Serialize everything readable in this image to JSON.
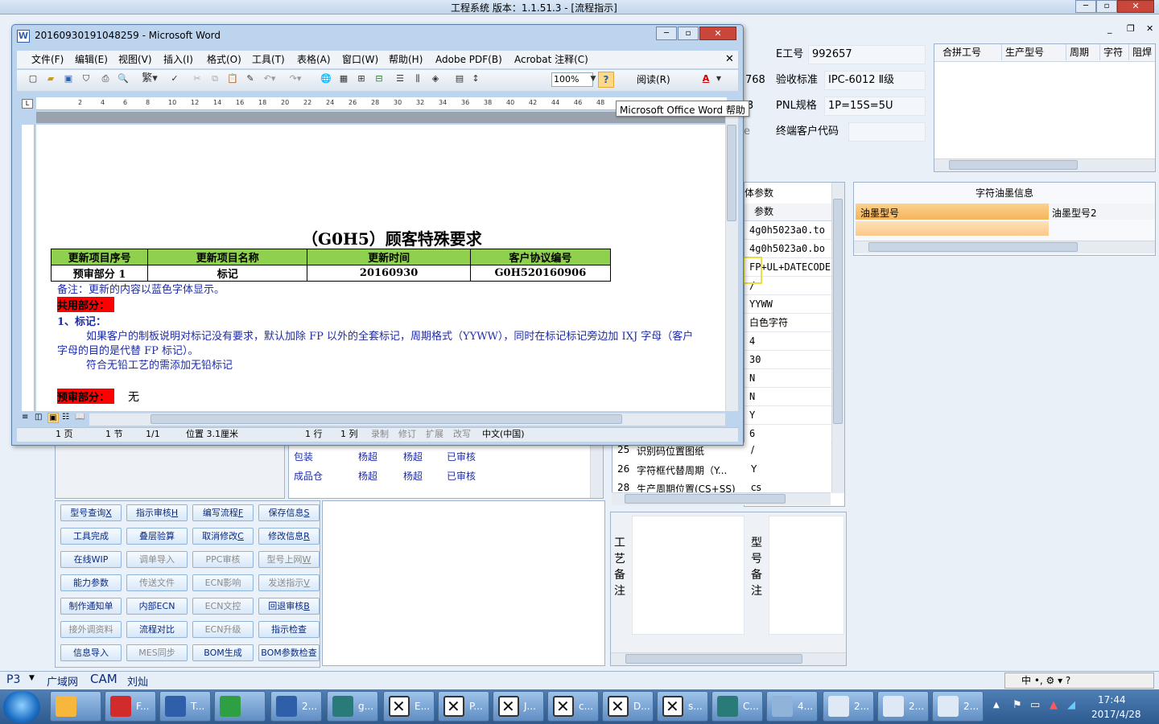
{
  "app": {
    "title": "工程系统   版本：1.1.51.3 - [流程指示]"
  },
  "top_fields": {
    "e_label": "E工号",
    "e_value": "992657",
    "acc_label": "验收标准",
    "acc_value": "IPC-6012 Ⅱ级",
    "acc_prefix": "768",
    "pnl_label": "PNL规格",
    "pnl_value": "1P=15S=5U",
    "pnl_prefix": "3",
    "client_label": "终端客户代码",
    "client_value": "",
    "client_prefix": "e"
  },
  "merge_grid": {
    "columns": [
      "合拼工号",
      "生产型号",
      "周期",
      "字符",
      "阻焊"
    ]
  },
  "params_panel": {
    "title_partial": "体参数",
    "col": "参数",
    "rows": [
      "4g0h5023a0.to",
      "4g0h5023a0.bo",
      "FP+UL+DATECODE",
      "/",
      "YYWW",
      "白色字符",
      "4",
      "30",
      "N",
      "N",
      "Y",
      "6"
    ]
  },
  "ink_panel": {
    "title": "字符油墨信息",
    "col1": "油墨型号",
    "col2": "油墨型号2"
  },
  "bottom_params": [
    {
      "no": "25",
      "name": "识别码位置图纸",
      "val": "/"
    },
    {
      "no": "26",
      "name": "字符框代替周期（Y...",
      "val": "Y"
    },
    {
      "no": "28",
      "name": "生产周期位置(CS+SS)",
      "val": "cs"
    }
  ],
  "approval_rows": [
    {
      "dept": "包装",
      "p1": "杨超",
      "p2": "杨超",
      "status": "已审核"
    },
    {
      "dept": "成品仓",
      "p1": "杨超",
      "p2": "杨超",
      "status": "已审核"
    }
  ],
  "buttons": [
    {
      "label": "型号查询",
      "key": "X",
      "dis": false
    },
    {
      "label": "指示审核",
      "key": "H",
      "dis": false
    },
    {
      "label": "编写流程",
      "key": "F",
      "dis": false
    },
    {
      "label": "保存信息",
      "key": "S",
      "dis": false
    },
    {
      "label": "工具完成",
      "key": "",
      "dis": false
    },
    {
      "label": "叠层验算",
      "key": "",
      "dis": false
    },
    {
      "label": "取消修改",
      "key": "C",
      "dis": false
    },
    {
      "label": "修改信息",
      "key": "R",
      "dis": false
    },
    {
      "label": "在线WIP",
      "key": "",
      "dis": false
    },
    {
      "label": "调单导入",
      "key": "",
      "dis": true
    },
    {
      "label": "PPC审核",
      "key": "",
      "dis": true
    },
    {
      "label": "型号上网",
      "key": "W",
      "dis": true
    },
    {
      "label": "能力参数",
      "key": "",
      "dis": false
    },
    {
      "label": "传送文件",
      "key": "",
      "dis": true
    },
    {
      "label": "ECN影响",
      "key": "",
      "dis": true
    },
    {
      "label": "发送指示",
      "key": "V",
      "dis": true
    },
    {
      "label": "制作通知单",
      "key": "",
      "dis": false
    },
    {
      "label": "内部ECN",
      "key": "",
      "dis": false
    },
    {
      "label": "ECN文控",
      "key": "",
      "dis": true
    },
    {
      "label": "回退审核",
      "key": "B",
      "dis": false
    },
    {
      "label": "接外调资料",
      "key": "",
      "dis": true
    },
    {
      "label": "流程对比",
      "key": "",
      "dis": false
    },
    {
      "label": "ECN升级",
      "key": "",
      "dis": true
    },
    {
      "label": "指示检查",
      "key": "",
      "dis": false
    },
    {
      "label": "信息导入",
      "key": "",
      "dis": false
    },
    {
      "label": "MES同步",
      "key": "",
      "dis": true
    },
    {
      "label": "BOM生成",
      "key": "",
      "dis": false
    },
    {
      "label": "BOM参数检查",
      "key": "",
      "dis": false
    }
  ],
  "notes": {
    "craft": "工艺备注",
    "model": "型号备注"
  },
  "status_tabs": [
    "P3",
    "广域网",
    "CAM",
    "刘灿"
  ],
  "word": {
    "title": "20160930191048259 - Microsoft Word",
    "menu": [
      "文件(F)",
      "编辑(E)",
      "视图(V)",
      "插入(I)",
      "格式(O)",
      "工具(T)",
      "表格(A)",
      "窗口(W)",
      "帮助(H)",
      "Adobe PDF(B)",
      "Acrobat 注释(C)"
    ],
    "zoom": "100%",
    "read_label": "阅读(R)",
    "tooltip": "Microsoft Office Word 帮助",
    "ruler": [
      "2",
      "4",
      "6",
      "8",
      "10",
      "12",
      "14",
      "16",
      "18",
      "20",
      "22",
      "24",
      "26",
      "28",
      "30",
      "32",
      "34",
      "36",
      "38",
      "40",
      "42",
      "44",
      "46",
      "48"
    ],
    "doc_title": "（G0H5）顾客特殊要求",
    "table_head": [
      "更新项目序号",
      "更新项目名称",
      "更新时间",
      "客户协议编号"
    ],
    "table_row": [
      "预审部分 1",
      "标记",
      "20160930",
      "G0H520160906"
    ],
    "note": "备注：更新的内容以蓝色字体显示。",
    "common": "共用部分：",
    "mark_head": "1、标记：",
    "para1": "如果客户的制板说明对标记没有要求，默认加除 FP 以外的全套标记，周期格式（YYWW），同时在标记标记旁边加 IXJ 字母（客户",
    "para2": "字母的目的是代替 FP 标记）。",
    "para3": "符合无铅工艺的需添加无铅标记",
    "pre": "预审部分：",
    "pre_val": "无",
    "status": {
      "page": "1 页",
      "sec": "1 节",
      "pages": "1/1",
      "pos": "位置 3.1厘米",
      "line": "1 行",
      "col": "1 列",
      "rec": "录制",
      "rev": "修订",
      "ext": "扩展",
      "ovr": "改写",
      "lang": "中文(中国)"
    }
  },
  "taskbar": {
    "items": [
      "F...",
      "T...",
      "",
      "2...",
      "g...",
      "E...",
      "P...",
      "J...",
      "c...",
      "D...",
      "s...",
      "C...",
      "4...",
      "2...",
      "2...",
      "2..."
    ],
    "time": "17:44",
    "date": "2017/4/28"
  },
  "colors": {
    "accent": "#0b2a80",
    "doc_green": "#8fd14f",
    "red_hl": "#ff0000",
    "blue_text": "#1f2ca8"
  }
}
